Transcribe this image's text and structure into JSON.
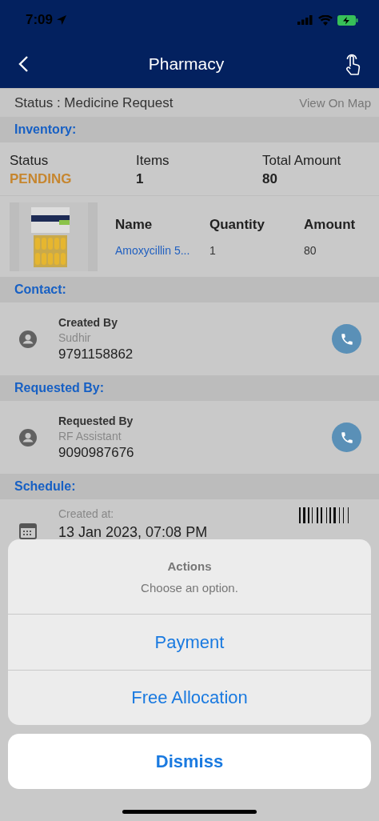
{
  "status_bar": {
    "time": "7:09"
  },
  "header": {
    "title": "Pharmacy"
  },
  "request_status": {
    "label": "Status : Medicine Request",
    "link": "View On Map"
  },
  "inventory": {
    "heading": "Inventory:",
    "stats": [
      {
        "label": "Status",
        "value": "PENDING",
        "kind": "status"
      },
      {
        "label": "Items",
        "value": "1",
        "kind": "plain"
      },
      {
        "label": "Total Amount",
        "value": "80",
        "kind": "plain"
      }
    ],
    "items": {
      "columns": [
        "Name",
        "Quantity",
        "Amount"
      ],
      "rows": [
        {
          "cells": [
            "Amoxycillin 5...",
            "1",
            "80"
          ]
        }
      ]
    }
  },
  "people": [
    {
      "heading": "Contact:",
      "label": "Created By",
      "name": "Sudhir",
      "phone": "9791158862"
    },
    {
      "heading": "Requested By:",
      "label": "Requested By",
      "name": "RF Assistant",
      "phone": "9090987676"
    }
  ],
  "schedule": {
    "heading": "Schedule:",
    "label": "Created at:",
    "value": "13 Jan 2023, 07:08 PM"
  },
  "action_sheet": {
    "title": "Actions",
    "message": "Choose an option.",
    "options": [
      "Payment",
      "Free Allocation"
    ],
    "cancel": "Dismiss"
  }
}
